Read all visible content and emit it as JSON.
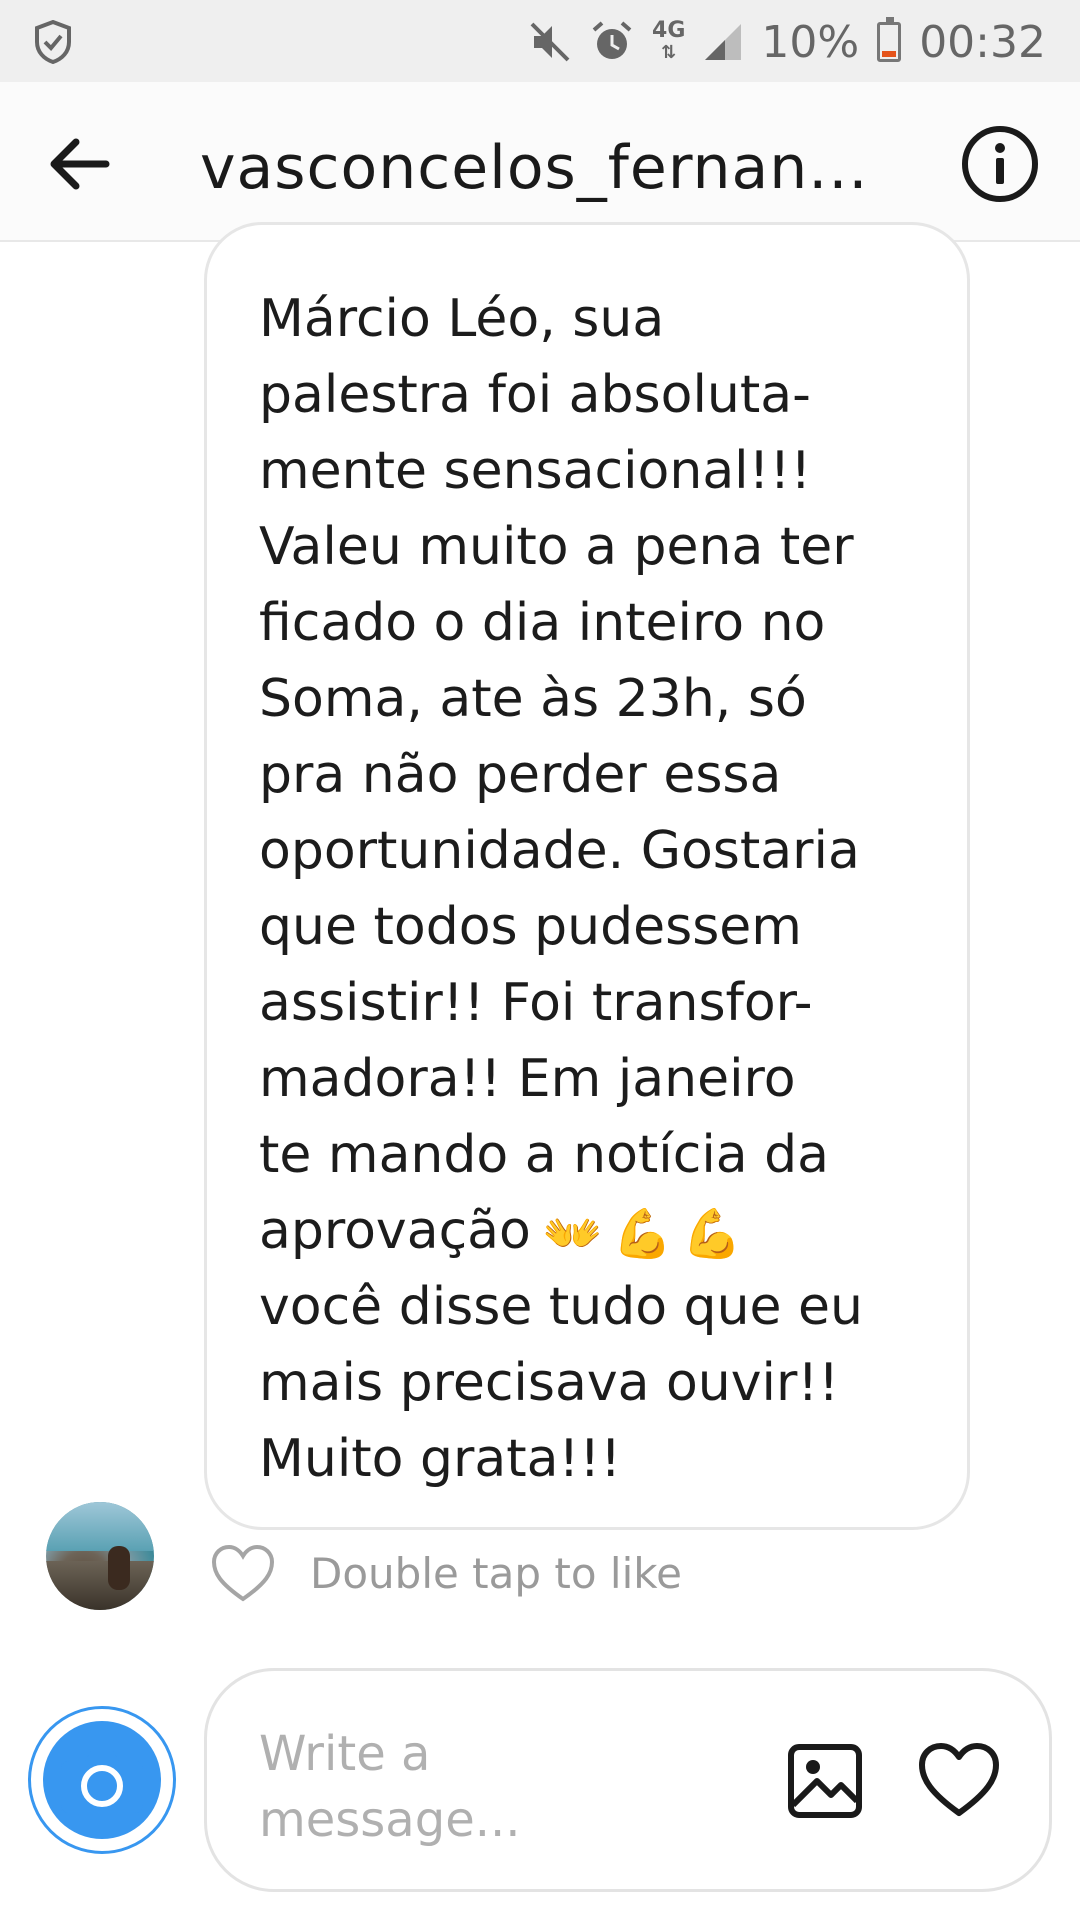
{
  "status_bar": {
    "battery_percent": "10%",
    "network": "4G",
    "time": "00:32"
  },
  "header": {
    "username": "vasconcelos_fernan..."
  },
  "message": {
    "text": "Márcio Léo, sua\npalestra foi absoluta-\nmente sensacional!!!\nValeu muito a pena ter\nficado o dia inteiro no\nSoma, ate às 23h, só\npra não perder essa\noportunidade. Gostaria\nque todos pudessem\nassistir!! Foi transfor-\nmadora!! Em janeiro\nte mando a notícia da\naprovação",
    "emojis": [
      "👐",
      "💪",
      "💪"
    ],
    "text_after": "você disse tudo que eu\nmais precisava ouvir!!\nMuito grata!!!"
  },
  "like_hint": "Double tap to like",
  "composer": {
    "placeholder": "Write a message..."
  },
  "colors": {
    "accent": "#3897f0",
    "battery_low": "#e5541b"
  },
  "icons": [
    "shield-check-icon",
    "mute-icon",
    "alarm-icon",
    "signal-icon",
    "battery-icon",
    "back-arrow-icon",
    "info-icon",
    "heart-icon",
    "camera-icon",
    "gallery-icon"
  ]
}
